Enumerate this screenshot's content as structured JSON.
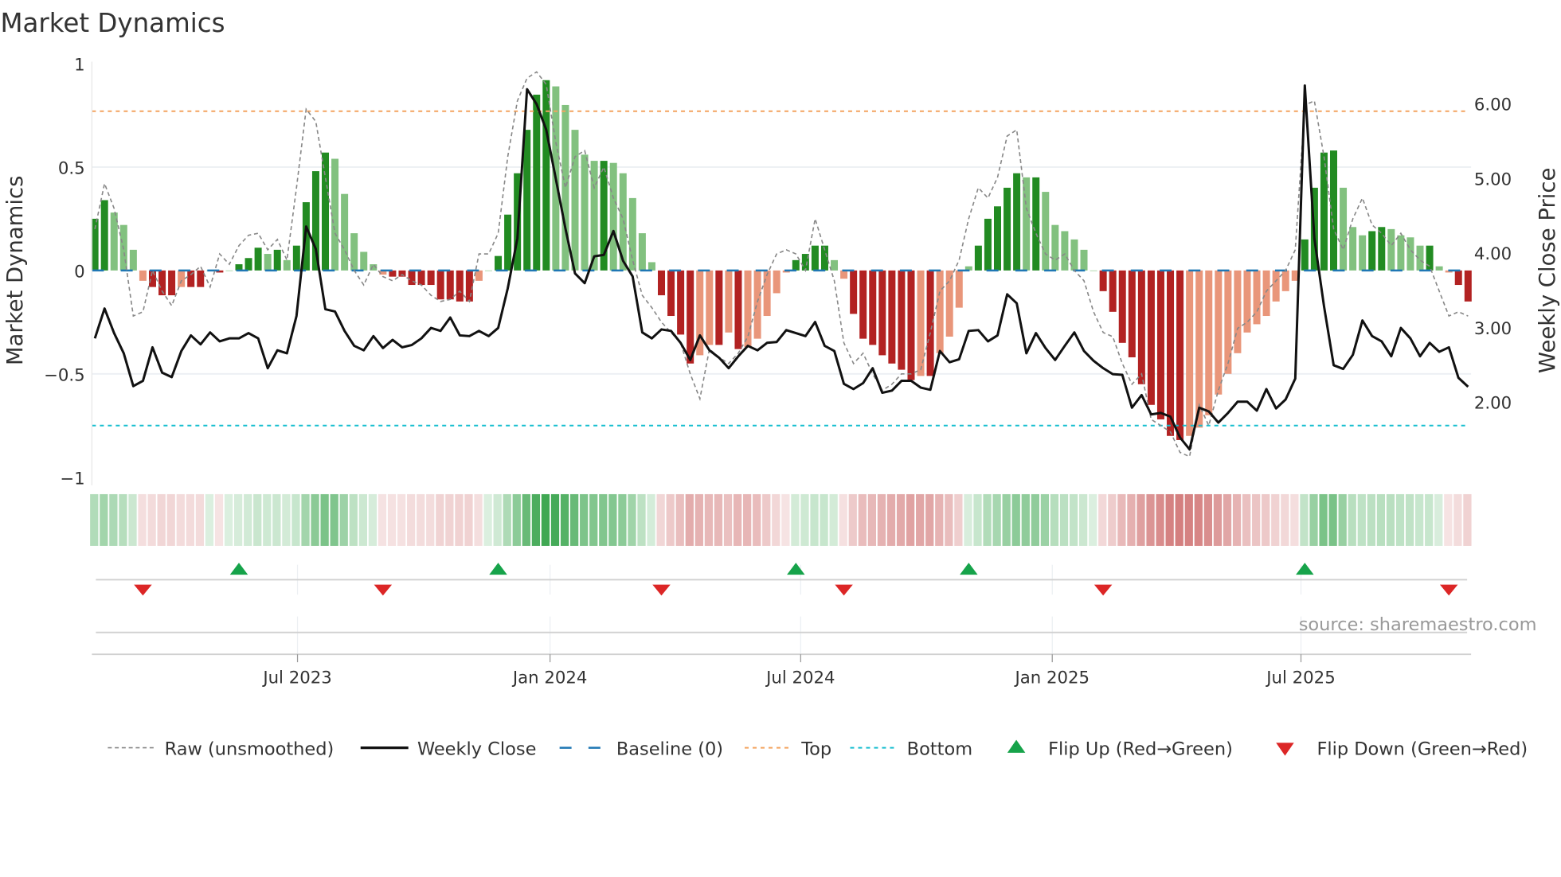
{
  "title": "Market Dynamics",
  "source": "source: sharemaestro.com",
  "chart_data": {
    "type": "bar",
    "title": "Market Dynamics",
    "ylabel": "Market Dynamics",
    "y2label": "Weekly Close Price",
    "ylim": [
      -1,
      1
    ],
    "y2lim": [
      1.0,
      6.9
    ],
    "yticks": [
      {
        "v": 1,
        "label": "1"
      },
      {
        "v": 0.5,
        "label": "0.5"
      },
      {
        "v": 0,
        "label": "0"
      },
      {
        "v": -0.5,
        "label": "−0.5"
      },
      {
        "v": -1,
        "label": "−1"
      }
    ],
    "y2ticks": [
      {
        "v": 6,
        "label": "6.00"
      },
      {
        "v": 5,
        "label": "5.00"
      },
      {
        "v": 4,
        "label": "4.00"
      },
      {
        "v": 3,
        "label": "3.00"
      },
      {
        "v": 2,
        "label": "2.00"
      }
    ],
    "xticks": [
      {
        "week": 21.1,
        "label": "Jul 2023"
      },
      {
        "week": 47.4,
        "label": "Jan 2024"
      },
      {
        "week": 73.5,
        "label": "Jul 2024"
      },
      {
        "week": 99.7,
        "label": "Jan 2025"
      },
      {
        "week": 125.6,
        "label": "Jul 2025"
      }
    ],
    "top": 0.77,
    "bottom": -0.75,
    "baseline": 0,
    "bars": [
      0.25,
      0.34,
      0.28,
      0.22,
      0.1,
      -0.05,
      -0.08,
      -0.12,
      -0.12,
      -0.08,
      -0.08,
      -0.08,
      0.0,
      -0.01,
      0.0,
      0.03,
      0.06,
      0.11,
      0.08,
      0.1,
      0.05,
      0.12,
      0.33,
      0.48,
      0.57,
      0.54,
      0.37,
      0.18,
      0.09,
      0.03,
      -0.02,
      -0.03,
      -0.03,
      -0.07,
      -0.07,
      -0.07,
      -0.14,
      -0.14,
      -0.15,
      -0.15,
      -0.05,
      0.0,
      0.07,
      0.27,
      0.47,
      0.68,
      0.85,
      0.92,
      0.89,
      0.8,
      0.68,
      0.56,
      0.53,
      0.53,
      0.52,
      0.47,
      0.35,
      0.18,
      0.04,
      -0.12,
      -0.22,
      -0.31,
      -0.45,
      -0.41,
      -0.36,
      -0.36,
      -0.3,
      -0.38,
      -0.37,
      -0.33,
      -0.22,
      -0.11,
      -0.01,
      0.05,
      0.08,
      0.12,
      0.12,
      0.05,
      -0.04,
      -0.21,
      -0.33,
      -0.36,
      -0.41,
      -0.45,
      -0.48,
      -0.53,
      -0.51,
      -0.51,
      -0.4,
      -0.32,
      -0.18,
      0.02,
      0.12,
      0.25,
      0.31,
      0.4,
      0.47,
      0.45,
      0.45,
      0.38,
      0.22,
      0.19,
      0.15,
      0.1,
      0.0,
      -0.1,
      -0.2,
      -0.35,
      -0.42,
      -0.55,
      -0.65,
      -0.72,
      -0.8,
      -0.82,
      -0.8,
      -0.76,
      -0.7,
      -0.6,
      -0.5,
      -0.4,
      -0.3,
      -0.26,
      -0.22,
      -0.15,
      -0.1,
      -0.05,
      0.15,
      0.4,
      0.57,
      0.58,
      0.4,
      0.21,
      0.17,
      0.19,
      0.21,
      0.2,
      0.17,
      0.16,
      0.12,
      0.12,
      0.02,
      -0.01,
      -0.07,
      -0.15
    ],
    "raw": [
      0.2,
      0.42,
      0.3,
      0.1,
      -0.22,
      -0.2,
      0.0,
      -0.1,
      -0.17,
      -0.05,
      -0.02,
      0.02,
      -0.08,
      0.08,
      0.03,
      0.12,
      0.17,
      0.18,
      0.1,
      0.15,
      0.05,
      0.4,
      0.78,
      0.72,
      0.45,
      0.18,
      0.1,
      0.0,
      -0.07,
      0.03,
      -0.03,
      -0.05,
      -0.02,
      -0.05,
      -0.07,
      -0.12,
      -0.15,
      -0.14,
      -0.1,
      -0.15,
      0.08,
      0.08,
      0.18,
      0.55,
      0.82,
      0.93,
      0.96,
      0.9,
      0.62,
      0.4,
      0.55,
      0.58,
      0.4,
      0.5,
      0.35,
      0.25,
      0.05,
      -0.12,
      -0.18,
      -0.25,
      -0.3,
      -0.35,
      -0.5,
      -0.62,
      -0.38,
      -0.42,
      -0.45,
      -0.4,
      -0.32,
      -0.15,
      -0.02,
      0.08,
      0.1,
      0.08,
      0.0,
      0.25,
      0.1,
      -0.05,
      -0.35,
      -0.45,
      -0.4,
      -0.5,
      -0.58,
      -0.55,
      -0.5,
      -0.5,
      -0.48,
      -0.3,
      -0.1,
      -0.05,
      0.05,
      0.25,
      0.4,
      0.35,
      0.45,
      0.65,
      0.68,
      0.3,
      0.18,
      0.08,
      0.05,
      0.08,
      0.0,
      -0.05,
      -0.2,
      -0.3,
      -0.32,
      -0.45,
      -0.55,
      -0.5,
      -0.72,
      -0.75,
      -0.78,
      -0.88,
      -0.9,
      -0.65,
      -0.75,
      -0.58,
      -0.45,
      -0.28,
      -0.25,
      -0.2,
      -0.1,
      -0.05,
      0.0,
      0.1,
      0.8,
      0.82,
      0.55,
      0.2,
      0.1,
      0.25,
      0.35,
      0.22,
      0.18,
      0.12,
      0.18,
      0.1,
      0.05,
      0.02,
      -0.1,
      -0.22,
      -0.2,
      -0.22
    ],
    "close": [
      2.85,
      3.25,
      2.92,
      2.65,
      2.21,
      2.28,
      2.73,
      2.39,
      2.33,
      2.68,
      2.89,
      2.77,
      2.93,
      2.81,
      2.85,
      2.85,
      2.92,
      2.85,
      2.45,
      2.69,
      2.65,
      3.15,
      4.35,
      4.05,
      3.24,
      3.21,
      2.95,
      2.75,
      2.69,
      2.88,
      2.72,
      2.83,
      2.73,
      2.76,
      2.85,
      2.99,
      2.95,
      3.13,
      2.89,
      2.88,
      2.95,
      2.88,
      2.99,
      3.52,
      4.19,
      6.19,
      5.99,
      5.65,
      4.99,
      4.32,
      3.72,
      3.59,
      3.95,
      3.97,
      4.29,
      3.89,
      3.68,
      2.93,
      2.85,
      2.97,
      2.95,
      2.79,
      2.56,
      2.89,
      2.69,
      2.59,
      2.45,
      2.61,
      2.75,
      2.69,
      2.79,
      2.8,
      2.96,
      2.92,
      2.88,
      3.07,
      2.75,
      2.68,
      2.24,
      2.17,
      2.25,
      2.45,
      2.12,
      2.15,
      2.28,
      2.28,
      2.19,
      2.16,
      2.68,
      2.53,
      2.57,
      2.95,
      2.96,
      2.81,
      2.89,
      3.44,
      3.32,
      2.65,
      2.92,
      2.72,
      2.56,
      2.75,
      2.93,
      2.68,
      2.55,
      2.45,
      2.37,
      2.36,
      1.92,
      2.09,
      1.83,
      1.85,
      1.8,
      1.52,
      1.36,
      1.92,
      1.87,
      1.72,
      1.85,
      2.0,
      2.0,
      1.88,
      2.17,
      1.91,
      2.03,
      2.31,
      6.24,
      4.19,
      3.28,
      2.49,
      2.44,
      2.63,
      3.09,
      2.88,
      2.81,
      2.61,
      2.99,
      2.85,
      2.61,
      2.79,
      2.67,
      2.73,
      2.32,
      2.2
    ],
    "flip_up_weeks": [
      15,
      42,
      73,
      91,
      126
    ],
    "flip_down_weeks": [
      5,
      30,
      59,
      78,
      105,
      141
    ],
    "legend": [
      {
        "label": "Raw (unsmoothed)",
        "kind": "dashed-gray"
      },
      {
        "label": "Weekly Close",
        "kind": "solid-black"
      },
      {
        "label": "Baseline (0)",
        "kind": "dashed-blue"
      },
      {
        "label": "Top",
        "kind": "dotted-orange"
      },
      {
        "label": "Bottom",
        "kind": "dotted-cyan"
      },
      {
        "label": "Flip Up (Red→Green)",
        "kind": "triangle-up"
      },
      {
        "label": "Flip Down (Green→Red)",
        "kind": "triangle-down"
      }
    ],
    "legend_position": "bottom",
    "colors": {
      "green_dark": "#228b22",
      "green_light": "#82c17f",
      "red_dark": "#b22222",
      "red_light": "#e9967a",
      "top": "#f4a460",
      "bottom": "#17becf",
      "baseline": "#1f77b4",
      "flip_up": "#16a34a",
      "flip_down": "#dc2626"
    }
  }
}
